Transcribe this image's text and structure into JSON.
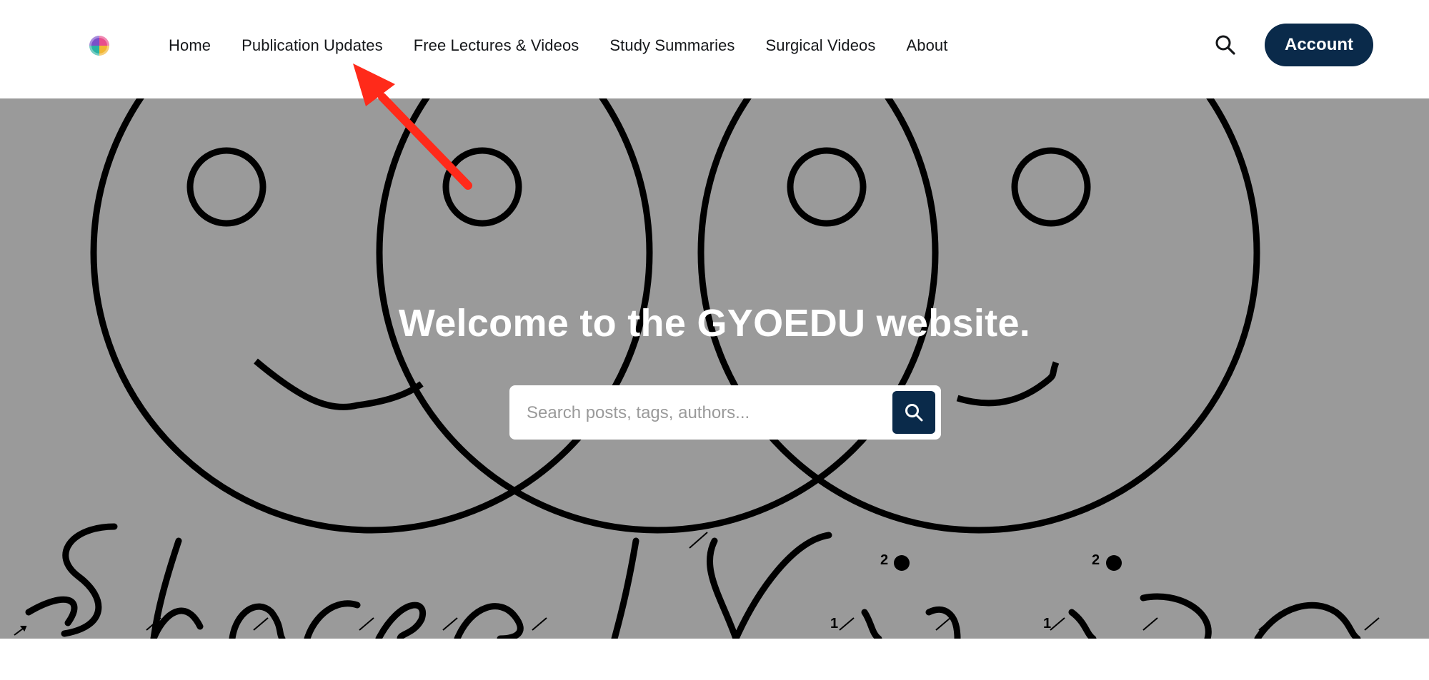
{
  "header": {
    "logo_name": "site-logo",
    "nav": [
      {
        "label": "Home"
      },
      {
        "label": "Publication Updates"
      },
      {
        "label": "Free Lectures & Videos"
      },
      {
        "label": "Study Summaries"
      },
      {
        "label": "Surgical Videos"
      },
      {
        "label": "About"
      }
    ],
    "search_icon": "search-icon",
    "account_label": "Account"
  },
  "hero": {
    "title": "Welcome to the GYOEDU website.",
    "search_placeholder": "Search posts, tags, authors...",
    "search_value": "",
    "search_button_icon": "search-icon",
    "background_text": "Shared Vision",
    "background_marks": [
      "2",
      "2",
      "1",
      "1"
    ]
  },
  "annotation": {
    "type": "arrow",
    "color": "#ff2a1a",
    "points_to": "Publication Updates"
  },
  "colors": {
    "accent": "#0a2a4a",
    "hero_background": "#9a9a9a",
    "annotation_arrow": "#ff2a1a"
  }
}
